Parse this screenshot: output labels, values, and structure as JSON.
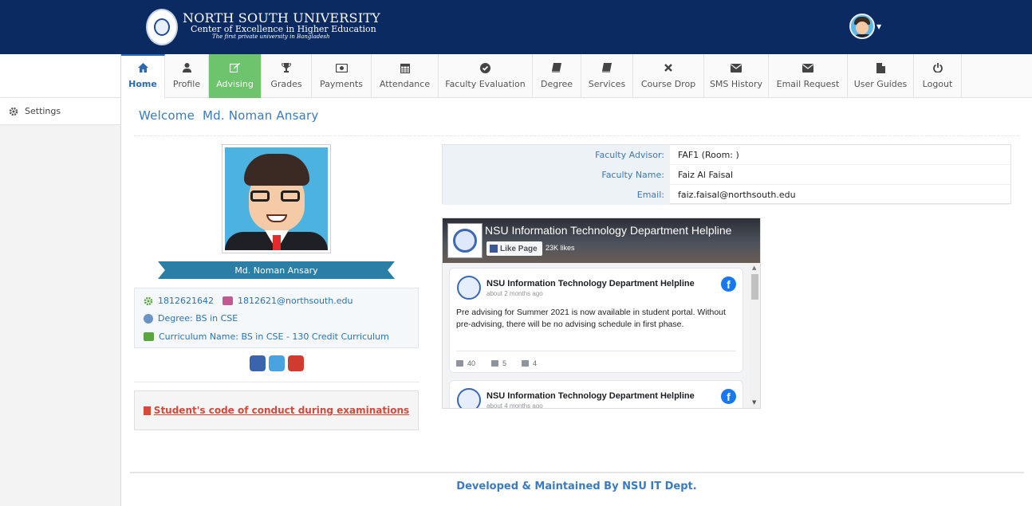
{
  "header": {
    "university_name": "NORTH SOUTH UNIVERSITY",
    "motto": "Center of Excellence in Higher Education",
    "tagline": "The first private university in Bangladesh"
  },
  "sidebar": {
    "settings_label": "Settings"
  },
  "nav": {
    "tabs": [
      {
        "label": "Home",
        "icon": "home-icon"
      },
      {
        "label": "Profile",
        "icon": "user-icon"
      },
      {
        "label": "Advising",
        "icon": "edit-icon"
      },
      {
        "label": "Grades",
        "icon": "trophy-icon"
      },
      {
        "label": "Payments",
        "icon": "money-icon"
      },
      {
        "label": "Attendance",
        "icon": "calendar-icon"
      },
      {
        "label": "Faculty Evaluation",
        "icon": "check-circle-icon"
      },
      {
        "label": "Degree",
        "icon": "book-icon"
      },
      {
        "label": "Services",
        "icon": "book-icon"
      },
      {
        "label": "Course Drop",
        "icon": "close-icon"
      },
      {
        "label": "SMS History",
        "icon": "envelope-icon"
      },
      {
        "label": "Email Request",
        "icon": "envelope-icon"
      },
      {
        "label": "User Guides",
        "icon": "file-icon"
      },
      {
        "label": "Logout",
        "icon": "power-icon"
      }
    ],
    "active_tab": "Home"
  },
  "welcome": {
    "greeting": "Welcome",
    "name": "Md. Noman Ansary"
  },
  "student": {
    "name": "Md. Noman Ansary",
    "id": "1812621642",
    "email": "1812621@northsouth.edu",
    "degree": "Degree: BS in CSE",
    "curriculum": "Curriculum Name: BS in CSE - 130 Credit Curriculum"
  },
  "social": [
    "facebook-icon",
    "instagram-icon",
    "youtube-icon"
  ],
  "conduct_link": "Student's code of conduct during examinations",
  "advisor": {
    "rows": [
      {
        "label": "Faculty Advisor:",
        "value": "FAF1 (Room: )"
      },
      {
        "label": "Faculty Name:",
        "value": "Faiz Al Faisal"
      },
      {
        "label": "Email:",
        "value": "faiz.faisal@northsouth.edu"
      }
    ]
  },
  "facebook": {
    "page_title": "NSU Information Technology Department Helpline",
    "like_button": "Like Page",
    "likes": "23K likes",
    "posts": [
      {
        "author": "NSU Information Technology Department Helpline",
        "time": "about 2 months ago",
        "text": "Pre advising for Summer 2021 is now available in student portal. Without pre-advising, there will be no advising schedule in first phase.",
        "likes": "40",
        "comments": "5",
        "shares": "4"
      },
      {
        "author": "NSU Information Technology Department Helpline",
        "time": "about 4 months ago"
      }
    ]
  },
  "footer": "Developed & Maintained By NSU IT Dept.",
  "colors": {
    "header_bg": "#0b2a62",
    "accent": "#3a7bbf",
    "advising_tab": "#6dc46d",
    "conduct_link": "#d44a3c"
  }
}
